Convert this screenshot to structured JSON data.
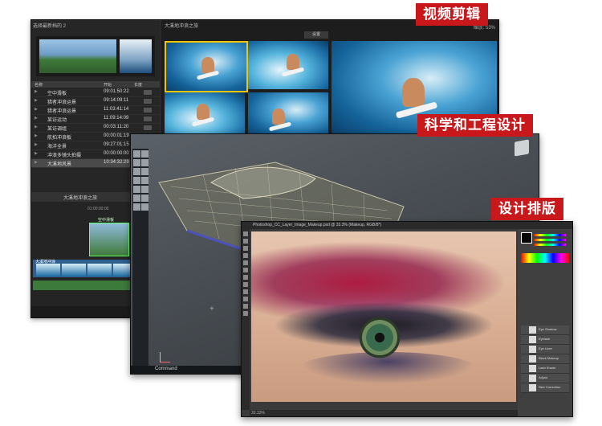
{
  "tags": {
    "video": "视频剪辑",
    "science": "科学和工程设计",
    "design": "设计排版"
  },
  "video_app": {
    "library_title": "选择最新档的 2",
    "browser_title": "大溪地冲浪之旅",
    "zoom_label": "缩放: 53%",
    "settings_label": "设置",
    "list_headers": {
      "name": "名称",
      "start": "开始",
      "duration": "长度"
    },
    "rows": [
      {
        "name": "空中滑板",
        "time": "09:01:50:22"
      },
      {
        "name": "猎者冲浪运景",
        "time": "09:14:09:11"
      },
      {
        "name": "猎者冲浪运景",
        "time": "11:03:41:14"
      },
      {
        "name": "某访运动",
        "time": "11:09:14:09"
      },
      {
        "name": "某访调组",
        "time": "00:03:11:20"
      },
      {
        "name": "航拍冲浪板",
        "time": "00:00:01:19"
      },
      {
        "name": "海洋全景",
        "time": "09:27:01:15"
      },
      {
        "name": "冲浪多镜头拍摄",
        "time": "00:00:00:00"
      },
      {
        "name": "大溪地风景",
        "time": "10:34:32:29"
      }
    ],
    "timeline_title": "大溪地冲浪之旅",
    "timecode": "01:00:00:00",
    "clip_label": "空中滑板",
    "track_label": "大溪地冲浪"
  },
  "cad_app": {
    "status_command": "Command"
  },
  "ps_app": {
    "doc_title": "Photoshop_CC_Layer_Image_Makeup.psd @ 33.3% (Makeup, RGB/8*)",
    "zoom": "33.33%",
    "layers": [
      "Eye Shadow",
      "Eyelash",
      "Eye Liner",
      "Black Makeup",
      "Lash Shade",
      "Adjust",
      "Skin Correction"
    ]
  }
}
